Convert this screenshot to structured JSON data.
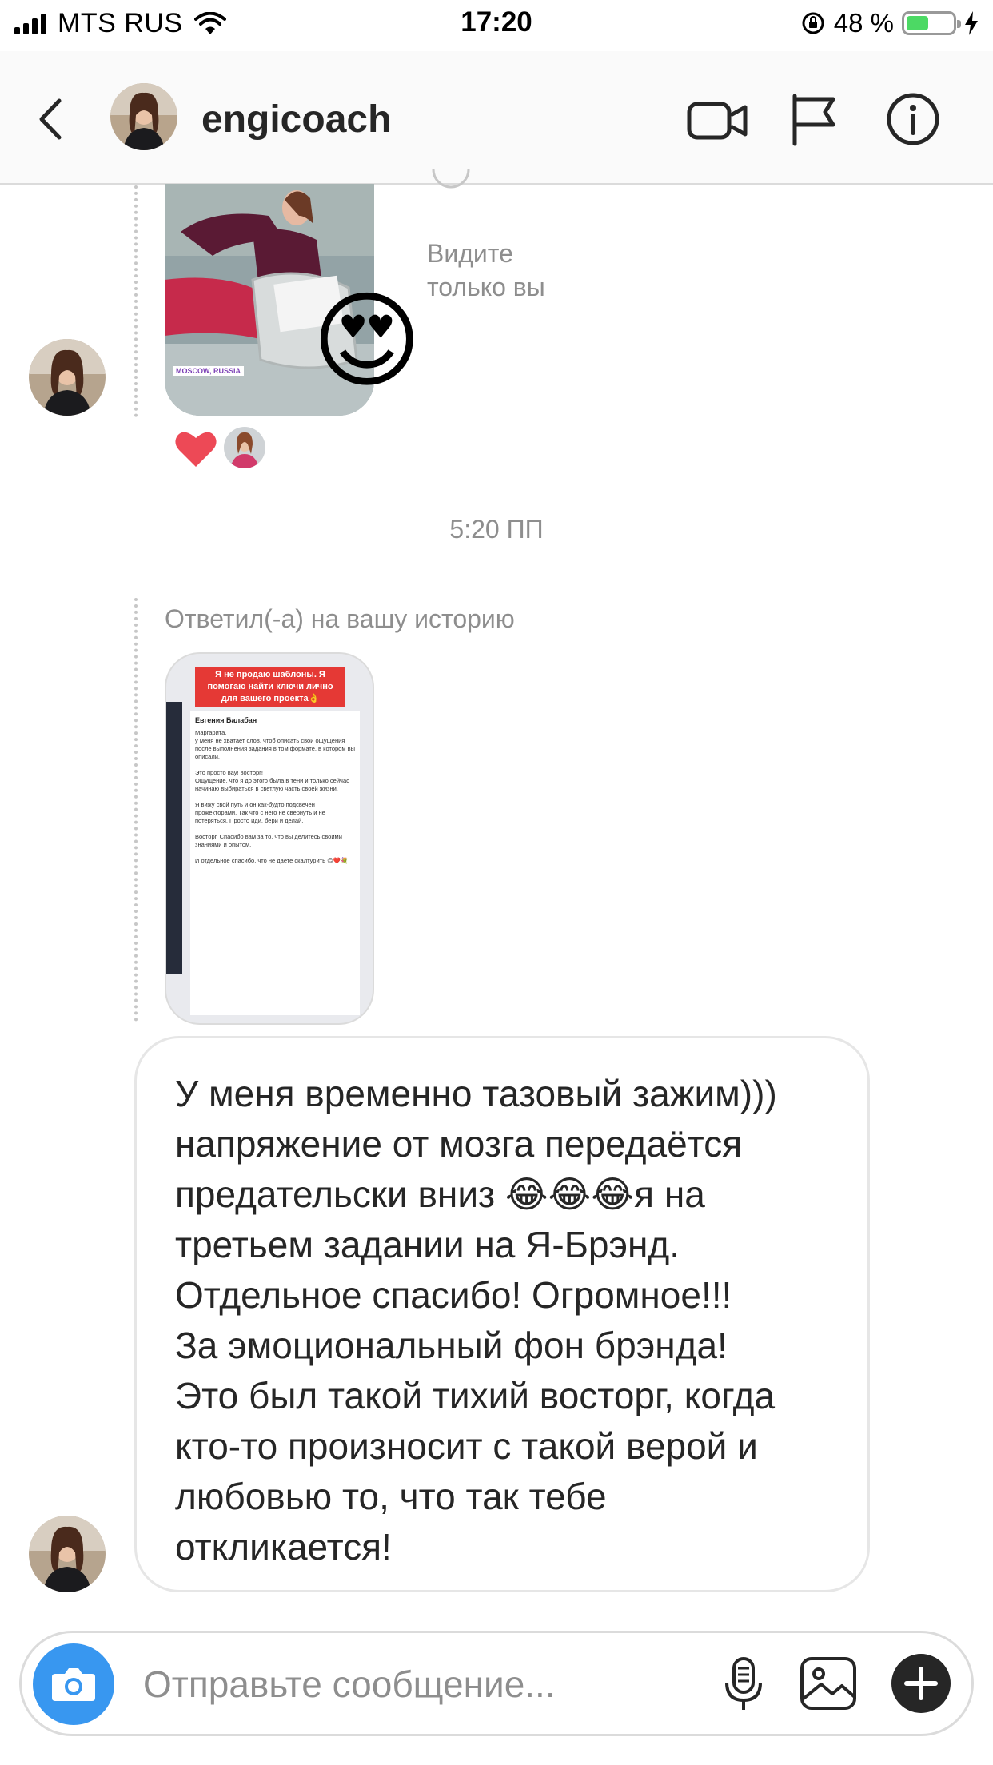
{
  "status_bar": {
    "carrier": "MTS RUS",
    "time": "17:20",
    "battery_percent": "48 %",
    "battery_level": 0.48
  },
  "header": {
    "username": "engicoach",
    "icons": [
      "back-icon",
      "video-call-icon",
      "flag-icon",
      "info-icon"
    ]
  },
  "messages": {
    "own_story_visibility": "Видите\nтолько вы",
    "reaction_emoji": "😍",
    "liked": true,
    "timestamp": "5:20 ПП",
    "story_reply_label": "Ответил(-а) на вашу историю",
    "story_preview": {
      "banner": "Я не продаю шаблоны. Я помогаю найти ключи лично для вашего проекта👌",
      "author": "Евгения Балабан",
      "body": "Маргарита,\nу меня не хватает слов, чтоб описать свои ощущения после выполнения задания в том формате, в котором вы описали.\n\nЭто просто вау! восторг!\nОщущение, что я до этого была в тени и только сейчас начинаю выбираться в светлую часть своей жизни.\n\nЯ вижу свой путь и он как-будто подсвечен прожекторами. Так что с него не свернуть и не потеряться. Просто иди, бери и делай.\n\nВосторг. Спасибо вам за то, что вы делитесь своими знаниями и опытом.\n\nИ отдельное спасибо, что не даете скалтурить 😊❤️💐"
    },
    "photo_location_tag": "MOSCOW, RUSSIA",
    "reply_text": "У меня временно тазовый зажим)))\nнапряжение от мозга передаётся\nпредательски вниз 😂😂😂я на\nтретьем задании на Я-Брэнд.\nОтдельное спасибо! Огромное!!!\nЗа эмоциональный фон брэнда!\nЭто был такой тихий восторг, когда\nкто-то произносит с такой верой и\nлюбовью то, что так тебе\nоткликается!"
  },
  "composer": {
    "placeholder": "Отправьте сообщение...",
    "icons": [
      "camera-icon",
      "microphone-icon",
      "gallery-icon",
      "add-icon"
    ]
  },
  "colors": {
    "accent": "#3897f0",
    "like": "#ed4956",
    "story_banner": "#e53935"
  }
}
